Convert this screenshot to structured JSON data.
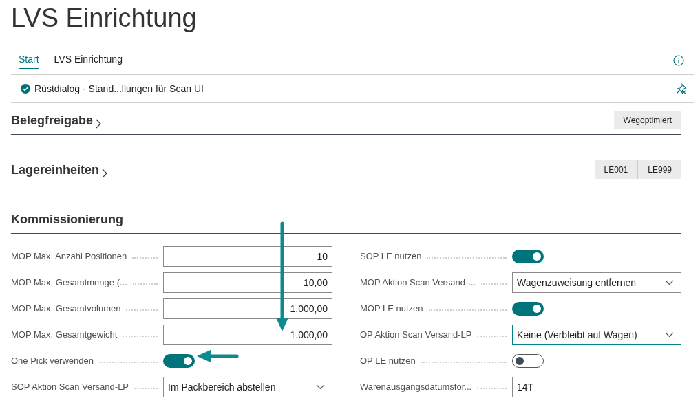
{
  "title": "LVS Einrichtung",
  "tabs": [
    {
      "label": "Start",
      "selected": true
    },
    {
      "label": "LVS Einrichtung",
      "selected": false
    }
  ],
  "info_bar": {
    "text": "Rüstdialog - Stand...llungen für Scan UI"
  },
  "sections": [
    {
      "title": "Belegfreigabe",
      "chevron": true,
      "buttons": [
        "Wegoptimiert"
      ]
    },
    {
      "title": "Lagereinheiten",
      "chevron": true,
      "buttons": [
        "LE001",
        "LE999"
      ]
    },
    {
      "title": "Kommissionierung",
      "chevron": false
    }
  ],
  "fields_left": [
    {
      "kind": "number",
      "label": "MOP Max. Anzahl Positionen",
      "value": "10"
    },
    {
      "kind": "number",
      "label": "MOP Max. Gesamtmenge (...",
      "value": "10,00"
    },
    {
      "kind": "number",
      "label": "MOP Max. Gesamtvolumen",
      "value": "1.000,00"
    },
    {
      "kind": "number",
      "label": "MOP Max. Gesamtgewicht",
      "value": "1.000,00"
    },
    {
      "kind": "toggle",
      "label": "One Pick verwenden",
      "on": true
    },
    {
      "kind": "select",
      "label": "SOP Aktion Scan Versand-LP",
      "value": "Im Packbereich abstellen",
      "focused": false
    }
  ],
  "fields_right": [
    {
      "kind": "toggle",
      "label": "SOP LE nutzen",
      "on": true
    },
    {
      "kind": "select",
      "label": "MOP Aktion Scan Versand-...",
      "value": "Wagenzuweisung entfernen",
      "focused": false
    },
    {
      "kind": "toggle",
      "label": "MOP LE nutzen",
      "on": true
    },
    {
      "kind": "select",
      "label": "OP Aktion Scan Versand-LP",
      "value": "Keine (Verbleibt auf Wagen)",
      "focused": true
    },
    {
      "kind": "toggle",
      "label": "OP LE nutzen",
      "on": false
    },
    {
      "kind": "text",
      "label": "Warenausgangsdatumsfor...",
      "value": "14T"
    }
  ]
}
